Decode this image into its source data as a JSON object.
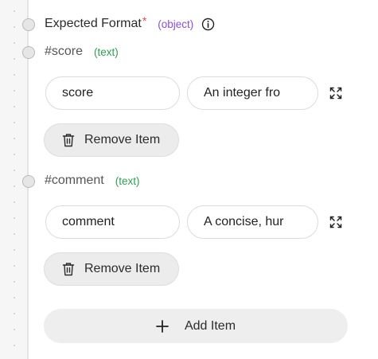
{
  "expected_format": {
    "label": "Expected Format",
    "required_marker": "*",
    "type": "(object)",
    "info_icon": "info-icon"
  },
  "items": [
    {
      "key": "#score",
      "type": "(text)",
      "name_value": "score",
      "description_value": "An integer fro",
      "remove_label": "Remove Item"
    },
    {
      "key": "#comment",
      "type": "(text)",
      "name_value": "comment",
      "description_value": "A concise, hur",
      "remove_label": "Remove Item"
    }
  ],
  "add_item_label": "Add Item",
  "colors": {
    "required": "#e5484d",
    "object_type": "#8a4fd8",
    "text_type": "#2f9e52",
    "button_bg": "#ececec"
  }
}
